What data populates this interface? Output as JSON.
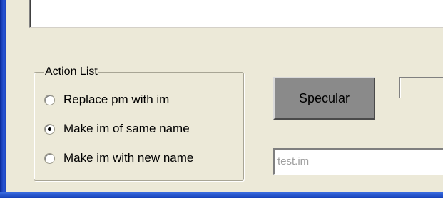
{
  "action_list": {
    "legend": "Action List",
    "options": [
      {
        "label": "Replace pm with im",
        "checked": false
      },
      {
        "label": "Make im of same name",
        "checked": true
      },
      {
        "label": "Make im with new name",
        "checked": false
      }
    ]
  },
  "specular_button": {
    "label": "Specular"
  },
  "new_name_field": {
    "value": "test.im"
  }
}
